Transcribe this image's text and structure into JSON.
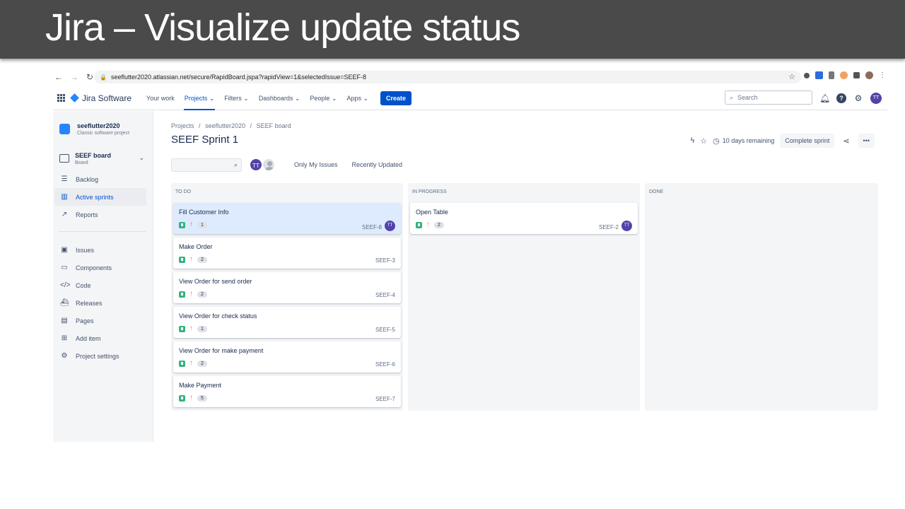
{
  "slide": {
    "title": "Jira – Visualize update status"
  },
  "browser": {
    "url": "seeflutter2020.atlassian.net/secure/RapidBoard.jspa?rapidView=1&selectedIssue=SEEF-8"
  },
  "topnav": {
    "product": "Jira Software",
    "items": [
      "Your work",
      "Projects ⌄",
      "Filters ⌄",
      "Dashboards ⌄",
      "People ⌄",
      "Apps ⌄"
    ],
    "create_label": "Create",
    "search_placeholder": "Search",
    "user_initials": "TT"
  },
  "sidebar": {
    "project_name": "seeflutter2020",
    "project_type": "Classic software project",
    "board_name": "SEEF board",
    "board_sub": "Board",
    "planning": [
      {
        "label": "Backlog",
        "icon": "backlog-icon"
      },
      {
        "label": "Active sprints",
        "icon": "board-icon"
      },
      {
        "label": "Reports",
        "icon": "reports-icon"
      }
    ],
    "dev": [
      {
        "label": "Issues",
        "icon": "issues-icon"
      },
      {
        "label": "Components",
        "icon": "components-icon"
      },
      {
        "label": "Code",
        "icon": "code-icon"
      },
      {
        "label": "Releases",
        "icon": "releases-icon"
      },
      {
        "label": "Pages",
        "icon": "pages-icon"
      },
      {
        "label": "Add item",
        "icon": "add-item-icon"
      },
      {
        "label": "Project settings",
        "icon": "gear-icon"
      }
    ]
  },
  "main": {
    "breadcrumb": [
      "Projects",
      "/",
      "seeflutter2020",
      "/",
      "SEEF board"
    ],
    "sprint_title": "SEEF Sprint 1",
    "remaining": "10 days remaining",
    "complete_label": "Complete sprint",
    "more_label": "•••",
    "filters": [
      "Only My Issues",
      "Recently Updated"
    ],
    "avatar_initials": "TT"
  },
  "columns": [
    {
      "title": "TO DO",
      "cards": [
        {
          "title": "Fill Customer Info",
          "points": "1",
          "key": "SEEF-8",
          "assignee": "TT",
          "selected": true
        },
        {
          "title": "Make Order",
          "points": "2",
          "key": "SEEF-3"
        },
        {
          "title": "View Order for send order",
          "points": "2",
          "key": "SEEF-4"
        },
        {
          "title": "View Order for check status",
          "points": "1",
          "key": "SEEF-5"
        },
        {
          "title": "View Order for make payment",
          "points": "2",
          "key": "SEEF-6"
        },
        {
          "title": "Make Payment",
          "points": "5",
          "key": "SEEF-7"
        }
      ]
    },
    {
      "title": "IN PROGRESS",
      "cards": [
        {
          "title": "Open Table",
          "points": "2",
          "key": "SEEF-2",
          "assignee": "TT"
        }
      ]
    },
    {
      "title": "DONE",
      "cards": []
    }
  ],
  "colors": {
    "accent": "#0052cc",
    "story": "#36b37e",
    "priority": "#ff7452",
    "avatar": "#5243aa"
  }
}
